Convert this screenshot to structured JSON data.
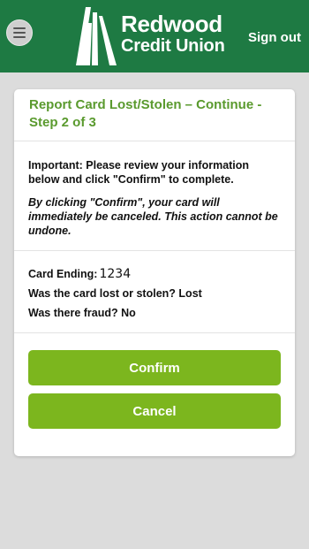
{
  "header": {
    "menu_icon": "hamburger-menu-icon",
    "logo_line1": "Redwood",
    "logo_line2": "Credit Union",
    "signout_label": "Sign out",
    "background_color": "#1e7a43"
  },
  "card": {
    "title": "Report Card Lost/Stolen – Continue - Step 2 of 3",
    "important_text": "Important: Please review your information below and click \"Confirm\" to complete.",
    "warning_text": "By clicking \"Confirm\", your card will immediately be canceled. This action cannot be undone.",
    "details": {
      "card_ending_label": "Card Ending:",
      "card_ending_value": "1234",
      "lost_or_stolen_label": "Was the card lost or stolen?",
      "lost_or_stolen_value": "Lost",
      "fraud_label": "Was there fraud?",
      "fraud_value": "No"
    },
    "confirm_label": "Confirm",
    "cancel_label": "Cancel",
    "title_color": "#5a9a2e",
    "button_color": "#7cb61e"
  }
}
